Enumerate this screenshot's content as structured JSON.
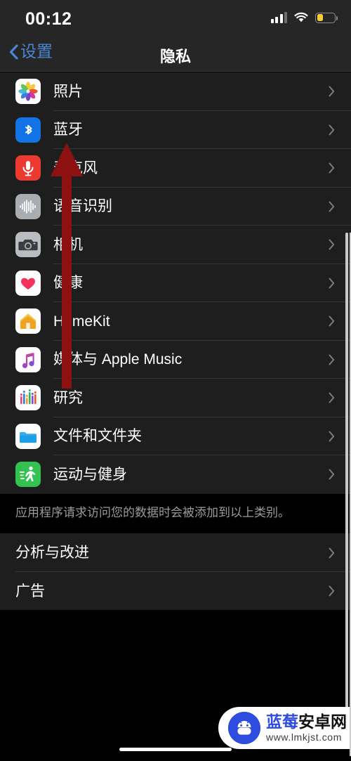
{
  "status_bar": {
    "time": "00:12",
    "signal_icon": "cellular-signal-icon",
    "signal_bars_filled": 3,
    "signal_bars_total": 4,
    "wifi_icon": "wifi-icon",
    "battery_icon": "battery-low-power-icon",
    "battery_level_percent": 30,
    "battery_color": "#f5cf3b"
  },
  "nav_bar": {
    "back_label": "设置",
    "back_icon": "chevron-left-icon",
    "title": "隐私",
    "accent_color": "#4a86d6"
  },
  "sections": [
    {
      "name": "privacy-categories",
      "rows": [
        {
          "label": "照片",
          "icon": "photos-app-icon",
          "chevron": "chevron-right-icon"
        },
        {
          "label": "蓝牙",
          "icon": "bluetooth-app-icon",
          "chevron": "chevron-right-icon"
        },
        {
          "label": "麦克风",
          "icon": "microphone-app-icon",
          "chevron": "chevron-right-icon"
        },
        {
          "label": "语音识别",
          "icon": "speech-recognition-icon",
          "chevron": "chevron-right-icon"
        },
        {
          "label": "相机",
          "icon": "camera-app-icon",
          "chevron": "chevron-right-icon"
        },
        {
          "label": "健康",
          "icon": "health-app-icon",
          "chevron": "chevron-right-icon"
        },
        {
          "label": "HomeKit",
          "icon": "homekit-app-icon",
          "chevron": "chevron-right-icon"
        },
        {
          "label": "媒体与 Apple Music",
          "icon": "music-app-icon",
          "chevron": "chevron-right-icon"
        },
        {
          "label": "研究",
          "icon": "research-app-icon",
          "chevron": "chevron-right-icon"
        },
        {
          "label": "文件和文件夹",
          "icon": "files-app-icon",
          "chevron": "chevron-right-icon"
        },
        {
          "label": "运动与健身",
          "icon": "motion-fitness-icon",
          "chevron": "chevron-right-icon"
        }
      ],
      "footer": "应用程序请求访问您的数据时会被添加到以上类别。"
    },
    {
      "name": "privacy-settings",
      "rows": [
        {
          "label": "分析与改进",
          "chevron": "chevron-right-icon"
        },
        {
          "label": "广告",
          "chevron": "chevron-right-icon"
        }
      ]
    }
  ],
  "annotation": {
    "arrow_icon": "up-arrow-annotation",
    "color": "#8e1111",
    "points_to": "蓝牙"
  },
  "watermark": {
    "logo_icon": "blueberry-android-logo-icon",
    "title_part_1": "蓝莓",
    "title_part_2": "安卓网",
    "url": "www.lmkjst.com",
    "brand_color": "#2f4ce0"
  },
  "home_indicator": {
    "icon": "home-indicator-bar"
  },
  "scrollbar": {
    "icon": "vertical-scrollbar"
  }
}
